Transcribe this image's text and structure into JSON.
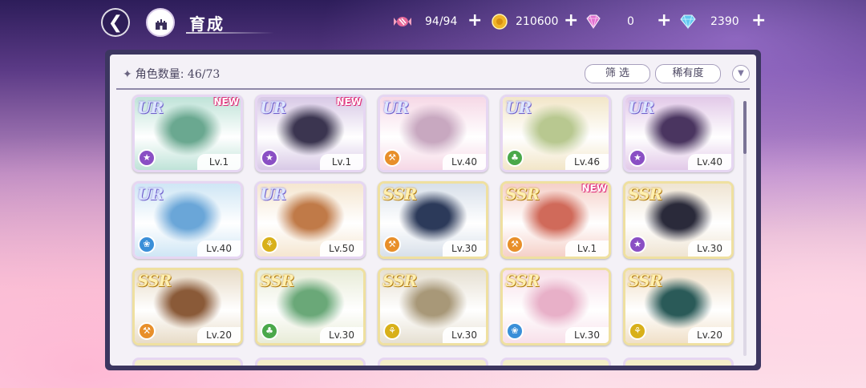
{
  "header": {
    "title": "育成",
    "resources": [
      {
        "icon": "candy-icon",
        "value": "94/94",
        "color": "#e86a9a"
      },
      {
        "icon": "gold-coin-icon",
        "value": "210600",
        "color": "#f0b428"
      },
      {
        "icon": "pink-gem-icon",
        "value": "0",
        "color": "#e070d0"
      },
      {
        "icon": "blue-diamond-icon",
        "value": "2390",
        "color": "#62c7f0"
      }
    ]
  },
  "panel": {
    "count_label": "角色数量:",
    "count_value": "46/73",
    "filter_label": "筛 选",
    "rarity_label": "稀有度"
  },
  "cards": [
    {
      "rarity": "UR",
      "new": "NEW",
      "level": "Lv.1",
      "element": "purple",
      "elementColor": "#8a4fc4",
      "bg": [
        "#bfe3d8",
        "#6aa890"
      ]
    },
    {
      "rarity": "UR",
      "new": "NEW",
      "level": "Lv.1",
      "element": "purple",
      "elementColor": "#8a4fc4",
      "bg": [
        "#d8c9e6",
        "#3b3550"
      ]
    },
    {
      "rarity": "UR",
      "new": "",
      "level": "Lv.40",
      "element": "orange",
      "elementColor": "#e88f2a",
      "bg": [
        "#f6d8e6",
        "#c8a8c0"
      ]
    },
    {
      "rarity": "UR",
      "new": "",
      "level": "Lv.46",
      "element": "green",
      "elementColor": "#4aa84a",
      "bg": [
        "#f2e6c8",
        "#b8c890"
      ]
    },
    {
      "rarity": "UR",
      "new": "",
      "level": "Lv.40",
      "element": "purple",
      "elementColor": "#8a4fc4",
      "bg": [
        "#e2c9e8",
        "#4a3560"
      ]
    },
    {
      "rarity": "UR",
      "new": "",
      "level": "Lv.40",
      "element": "blue",
      "elementColor": "#3a8fd8",
      "bg": [
        "#cfe6f5",
        "#6aa6d8"
      ]
    },
    {
      "rarity": "UR",
      "new": "",
      "level": "Lv.50",
      "element": "yellow",
      "elementColor": "#d8b01a",
      "bg": [
        "#f5e6d0",
        "#c07a48"
      ]
    },
    {
      "rarity": "SSR",
      "new": "",
      "level": "Lv.30",
      "element": "orange",
      "elementColor": "#e88f2a",
      "bg": [
        "#d8e0ea",
        "#2c3a5a"
      ]
    },
    {
      "rarity": "SSR",
      "new": "NEW",
      "level": "Lv.1",
      "element": "orange",
      "elementColor": "#e88f2a",
      "bg": [
        "#f5d0c8",
        "#d06a5a"
      ]
    },
    {
      "rarity": "SSR",
      "new": "",
      "level": "Lv.30",
      "element": "purple",
      "elementColor": "#8a4fc4",
      "bg": [
        "#efe4d2",
        "#2a2a3a"
      ]
    },
    {
      "rarity": "SSR",
      "new": "",
      "level": "Lv.20",
      "element": "orange",
      "elementColor": "#e88f2a",
      "bg": [
        "#e8dcc8",
        "#8a5a38"
      ]
    },
    {
      "rarity": "SSR",
      "new": "",
      "level": "Lv.30",
      "element": "green",
      "elementColor": "#4aa84a",
      "bg": [
        "#e8ecd8",
        "#6aa878"
      ]
    },
    {
      "rarity": "SSR",
      "new": "",
      "level": "Lv.30",
      "element": "yellow",
      "elementColor": "#d8b01a",
      "bg": [
        "#e6e0d2",
        "#a89878"
      ]
    },
    {
      "rarity": "SSR",
      "new": "",
      "level": "Lv.30",
      "element": "blue",
      "elementColor": "#3a8fd8",
      "bg": [
        "#f8e0ea",
        "#e8b0c8"
      ]
    },
    {
      "rarity": "SSR",
      "new": "",
      "level": "Lv.20",
      "element": "yellow",
      "elementColor": "#d8b01a",
      "bg": [
        "#f0e0c8",
        "#2a5a58"
      ]
    }
  ]
}
